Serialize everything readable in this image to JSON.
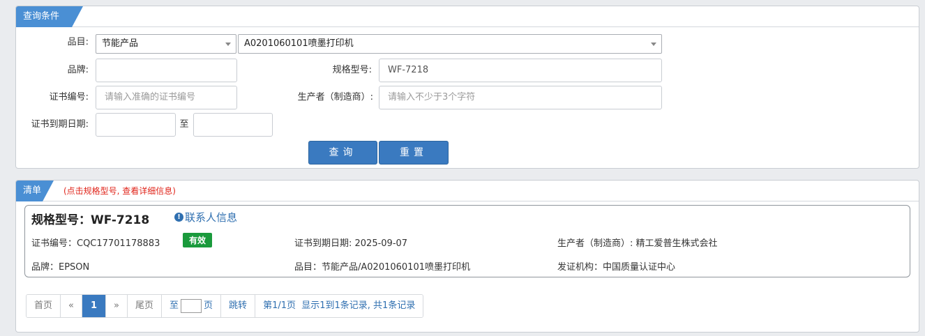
{
  "query": {
    "tab_label": "查询条件",
    "category_label": "品目:",
    "category_value": "节能产品",
    "subcategory_value": "A0201060101喷墨打印机",
    "brand_label": "品牌:",
    "brand_value": "",
    "model_label": "规格型号:",
    "model_value": "WF-7218",
    "cert_no_label": "证书编号:",
    "cert_no_placeholder": "请输入准确的证书编号",
    "maker_label": "生产者（制造商）:",
    "maker_placeholder": "请输入不少于3个字符",
    "expire_label": "证书到期日期:",
    "expire_to": "至",
    "search_button": "查询",
    "reset_button": "重置"
  },
  "list": {
    "tab_label": "清单",
    "hint": "(点击规格型号, 查看详细信息)",
    "record": {
      "title": "规格型号：WF-7218",
      "contact_link": "联系人信息",
      "cert_no": "证书编号：CQC17701178883",
      "status": "有效",
      "expire": "证书到期日期: 2025-09-07",
      "maker": "生产者（制造商）: 精工爱普生株式会社",
      "brand": "品牌：EPSON",
      "category": "品目：节能产品/A0201060101喷墨打印机",
      "issuer": "发证机构：中国质量认证中心"
    },
    "pager": {
      "first": "首页",
      "prev": "«",
      "current": "1",
      "next": "»",
      "last": "尾页",
      "goto_prefix": "至",
      "goto_suffix": "页",
      "jump": "跳转",
      "summary": "第1/1页  显示1到1条记录, 共1条记录"
    }
  },
  "colors": {
    "accent": "#4a8fd4",
    "button": "#3a7ac0",
    "status_valid": "#1a9a3c",
    "hint": "#e0251b"
  }
}
